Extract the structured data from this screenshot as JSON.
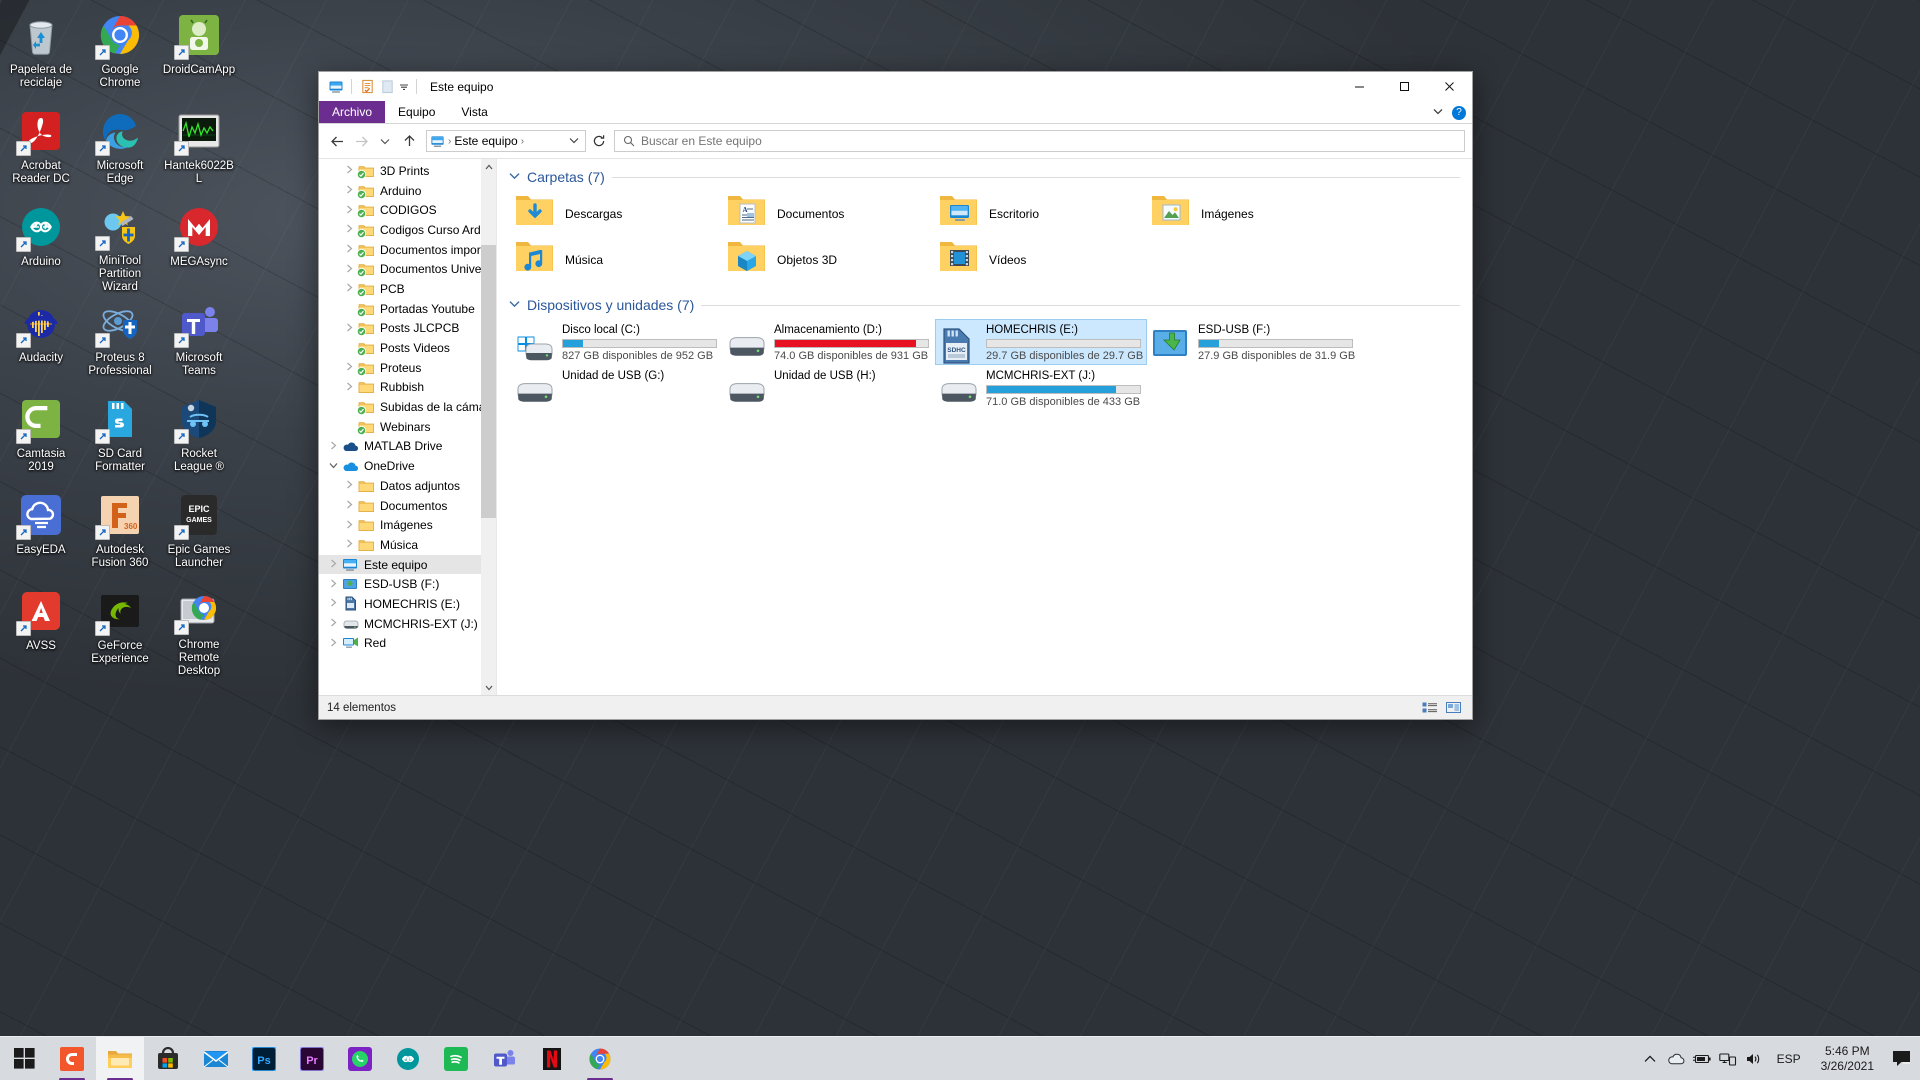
{
  "desktop": {
    "icons": [
      {
        "label": "Papelera de reciclaje",
        "icon": "recycle-bin-icon",
        "shortcut": false
      },
      {
        "label": "Google Chrome",
        "icon": "chrome-icon",
        "shortcut": true
      },
      {
        "label": "DroidCamApp",
        "icon": "droidcam-icon",
        "shortcut": true
      },
      {
        "label": "Acrobat Reader DC",
        "icon": "acrobat-reader-icon",
        "shortcut": true
      },
      {
        "label": "Microsoft Edge",
        "icon": "edge-icon",
        "shortcut": true
      },
      {
        "label": "Hantek6022BL",
        "icon": "hantek-icon",
        "shortcut": true
      },
      {
        "label": "Arduino",
        "icon": "arduino-icon",
        "shortcut": true
      },
      {
        "label": "MiniTool Partition Wizard",
        "icon": "minitool-icon",
        "shortcut": true
      },
      {
        "label": "MEGAsync",
        "icon": "megasync-icon",
        "shortcut": true
      },
      {
        "label": "Audacity",
        "icon": "audacity-icon",
        "shortcut": true
      },
      {
        "label": "Proteus 8 Professional",
        "icon": "proteus-icon",
        "shortcut": true
      },
      {
        "label": "Microsoft Teams",
        "icon": "teams-icon",
        "shortcut": true
      },
      {
        "label": "Camtasia 2019",
        "icon": "camtasia-icon",
        "shortcut": true
      },
      {
        "label": "SD Card Formatter",
        "icon": "sdcard-icon",
        "shortcut": true
      },
      {
        "label": "Rocket League ®",
        "icon": "rocket-league-icon",
        "shortcut": true
      },
      {
        "label": "EasyEDA",
        "icon": "easyeda-icon",
        "shortcut": true
      },
      {
        "label": "Autodesk Fusion 360",
        "icon": "fusion360-icon",
        "shortcut": true
      },
      {
        "label": "Epic Games Launcher",
        "icon": "epic-games-icon",
        "shortcut": true
      },
      {
        "label": "AVSS",
        "icon": "avss-icon",
        "shortcut": true
      },
      {
        "label": "GeForce Experience",
        "icon": "geforce-icon",
        "shortcut": true
      },
      {
        "label": "Chrome Remote Desktop",
        "icon": "chrome-remote-desktop-icon",
        "shortcut": true
      }
    ]
  },
  "window": {
    "title": "Este equipo",
    "quick_access": [
      "this-pc-icon",
      "properties-icon",
      "new-folder-icon",
      "customize-chevron-icon"
    ],
    "buttons": {
      "minimize": "—",
      "maximize": "☐",
      "close": "✕"
    },
    "ribbon_tabs": [
      {
        "label": "Archivo",
        "active": true
      },
      {
        "label": "Equipo",
        "active": false
      },
      {
        "label": "Vista",
        "active": false
      }
    ],
    "help_label": "?",
    "nav": {
      "back": "back-arrow",
      "forward": "forward-arrow",
      "recent": "recent-chevron",
      "up": "up-arrow",
      "refresh": "refresh-icon",
      "breadcrumb": [
        "Este equipo"
      ],
      "breadcrumb_icon": "this-pc-icon"
    },
    "search": {
      "placeholder": "Buscar en Este equipo",
      "value": "",
      "icon": "search-icon"
    },
    "status": {
      "item_count": "14 elementos"
    },
    "view_buttons": [
      "details-view-icon",
      "large-icons-view-icon"
    ]
  },
  "navpane": {
    "items": [
      {
        "label": "3D Prints",
        "icon": "folder-synced-icon",
        "indent": 1,
        "twisty": "collapsed"
      },
      {
        "label": "Arduino",
        "icon": "folder-synced-icon",
        "indent": 1,
        "twisty": "collapsed"
      },
      {
        "label": "CODIGOS",
        "icon": "folder-synced-icon",
        "indent": 1,
        "twisty": "collapsed"
      },
      {
        "label": "Codigos Curso Arduino",
        "icon": "folder-synced-icon",
        "indent": 1,
        "twisty": "collapsed"
      },
      {
        "label": "Documentos importantes",
        "icon": "folder-synced-icon",
        "indent": 1,
        "twisty": "collapsed"
      },
      {
        "label": "Documentos Universidad",
        "icon": "folder-synced-icon",
        "indent": 1,
        "twisty": "collapsed"
      },
      {
        "label": "PCB",
        "icon": "folder-synced-icon",
        "indent": 1,
        "twisty": "collapsed"
      },
      {
        "label": "Portadas Youtube",
        "icon": "folder-synced-icon",
        "indent": 1,
        "twisty": "none"
      },
      {
        "label": "Posts JLCPCB",
        "icon": "folder-synced-icon",
        "indent": 1,
        "twisty": "collapsed"
      },
      {
        "label": "Posts Videos",
        "icon": "folder-synced-icon",
        "indent": 1,
        "twisty": "none"
      },
      {
        "label": "Proteus",
        "icon": "folder-synced-icon",
        "indent": 1,
        "twisty": "collapsed"
      },
      {
        "label": "Rubbish",
        "icon": "folder-icon",
        "indent": 1,
        "twisty": "collapsed"
      },
      {
        "label": "Subidas de la cámara",
        "icon": "folder-synced-icon",
        "indent": 1,
        "twisty": "none"
      },
      {
        "label": "Webinars",
        "icon": "folder-synced-icon",
        "indent": 1,
        "twisty": "none"
      },
      {
        "label": "MATLAB Drive",
        "icon": "matlab-drive-icon",
        "indent": 0,
        "twisty": "collapsed"
      },
      {
        "label": "OneDrive",
        "icon": "onedrive-icon",
        "indent": 0,
        "twisty": "expanded"
      },
      {
        "label": "Datos adjuntos",
        "icon": "folder-icon",
        "indent": 1,
        "twisty": "collapsed"
      },
      {
        "label": "Documentos",
        "icon": "folder-icon",
        "indent": 1,
        "twisty": "collapsed"
      },
      {
        "label": "Imágenes",
        "icon": "folder-icon",
        "indent": 1,
        "twisty": "collapsed"
      },
      {
        "label": "Música",
        "icon": "folder-icon",
        "indent": 1,
        "twisty": "collapsed"
      },
      {
        "label": "Este equipo",
        "icon": "this-pc-icon",
        "indent": 0,
        "twisty": "collapsed",
        "selected": true
      },
      {
        "label": "ESD-USB (F:)",
        "icon": "usb-drive-icon",
        "indent": 0,
        "twisty": "collapsed"
      },
      {
        "label": "HOMECHRIS (E:)",
        "icon": "sdcard-drive-icon",
        "indent": 0,
        "twisty": "collapsed"
      },
      {
        "label": "MCMCHRIS-EXT (J:)",
        "icon": "hdd-icon",
        "indent": 0,
        "twisty": "collapsed"
      },
      {
        "label": "Red",
        "icon": "network-icon",
        "indent": 0,
        "twisty": "collapsed"
      }
    ]
  },
  "content": {
    "groups": [
      {
        "title": "Carpetas (7)",
        "chevron": "chevron-down-icon",
        "items": [
          {
            "name": "Descargas",
            "icon": "folder-downloads-icon"
          },
          {
            "name": "Documentos",
            "icon": "folder-documents-icon"
          },
          {
            "name": "Escritorio",
            "icon": "folder-desktop-icon"
          },
          {
            "name": "Imágenes",
            "icon": "folder-pictures-icon"
          },
          {
            "name": "Música",
            "icon": "folder-music-icon"
          },
          {
            "name": "Objetos 3D",
            "icon": "folder-3dobjects-icon"
          },
          {
            "name": "Vídeos",
            "icon": "folder-videos-icon"
          }
        ]
      },
      {
        "title": "Dispositivos y unidades (7)",
        "chevron": "chevron-down-icon",
        "drives": [
          {
            "name": "Disco local (C:)",
            "free_text": "827 GB disponibles de 952 GB",
            "used_percent": 13,
            "bar_color": "#26a0da",
            "icon": "windows-drive-icon",
            "has_bar": true,
            "selected": false
          },
          {
            "name": "Almacenamiento (D:)",
            "free_text": "74.0 GB disponibles de 931 GB",
            "used_percent": 92,
            "bar_color": "#e81123",
            "icon": "hdd-icon",
            "has_bar": true,
            "selected": false
          },
          {
            "name": "HOMECHRIS (E:)",
            "free_text": "29.7 GB disponibles de 29.7 GB",
            "used_percent": 0,
            "bar_color": "#26a0da",
            "icon": "sdcard-drive-icon",
            "has_bar": true,
            "selected": true
          },
          {
            "name": "ESD-USB (F:)",
            "free_text": "27.9 GB disponibles de 31.9 GB",
            "used_percent": 13,
            "bar_color": "#26a0da",
            "icon": "usb-drive-icon",
            "has_bar": true,
            "selected": false
          },
          {
            "name": "Unidad de USB (G:)",
            "free_text": "",
            "used_percent": 0,
            "bar_color": "#26a0da",
            "icon": "removable-drive-icon",
            "has_bar": false,
            "selected": false
          },
          {
            "name": "Unidad de USB (H:)",
            "free_text": "",
            "used_percent": 0,
            "bar_color": "#26a0da",
            "icon": "removable-drive-icon",
            "has_bar": false,
            "selected": false
          },
          {
            "name": "MCMCHRIS-EXT (J:)",
            "free_text": "71.0 GB disponibles de 433 GB",
            "used_percent": 84,
            "bar_color": "#26a0da",
            "icon": "hdd-icon",
            "has_bar": true,
            "selected": false
          }
        ]
      }
    ]
  },
  "taskbar": {
    "start": "windows-start-icon",
    "items": [
      {
        "name": "camtasia-taskbar-icon",
        "label": "C",
        "bg": "#f4562c",
        "running": true,
        "active": false
      },
      {
        "name": "file-explorer-taskbar-icon",
        "label": "",
        "bg": "#f7b32b",
        "running": true,
        "active": true
      },
      {
        "name": "microsoft-store-taskbar-icon",
        "label": "",
        "bg": "#2b2b2b",
        "running": false,
        "active": false
      },
      {
        "name": "mail-taskbar-icon",
        "label": "",
        "bg": "#0b7bd4",
        "running": false,
        "active": false
      },
      {
        "name": "photoshop-taskbar-icon",
        "label": "Ps",
        "bg": "#001e36",
        "running": false,
        "active": false
      },
      {
        "name": "premiere-taskbar-icon",
        "label": "Pr",
        "bg": "#2a0634",
        "running": false,
        "active": false
      },
      {
        "name": "whatsapp-taskbar-icon",
        "label": "",
        "bg": "#7d22c3",
        "running": false,
        "active": false
      },
      {
        "name": "arduino-taskbar-icon",
        "label": "∞",
        "bg": "#00979c",
        "running": false,
        "active": false
      },
      {
        "name": "spotify-taskbar-icon",
        "label": "",
        "bg": "#1db954",
        "running": false,
        "active": false
      },
      {
        "name": "teams-taskbar-icon",
        "label": "T",
        "bg": "#5059c9",
        "running": false,
        "active": false
      },
      {
        "name": "netflix-taskbar-icon",
        "label": "N",
        "bg": "#141414",
        "running": false,
        "active": false
      },
      {
        "name": "chrome-taskbar-icon",
        "label": "",
        "bg": "#ffffff",
        "running": true,
        "active": false
      }
    ],
    "tray": {
      "show_hidden": "chevron-up-icon",
      "icons": [
        "onedrive-tray-icon",
        "battery-tray-icon",
        "network-tray-icon",
        "volume-tray-icon"
      ],
      "language": "ESP",
      "time": "5:46 PM",
      "date": "3/26/2021",
      "action_center": "action-center-icon"
    }
  },
  "colors": {
    "accent": "#0078d7",
    "file_tab": "#6c2d91",
    "selection": "#cce8ff",
    "drive_bar_blue": "#26a0da",
    "drive_bar_red": "#e81123",
    "group_title": "#2b579a"
  }
}
